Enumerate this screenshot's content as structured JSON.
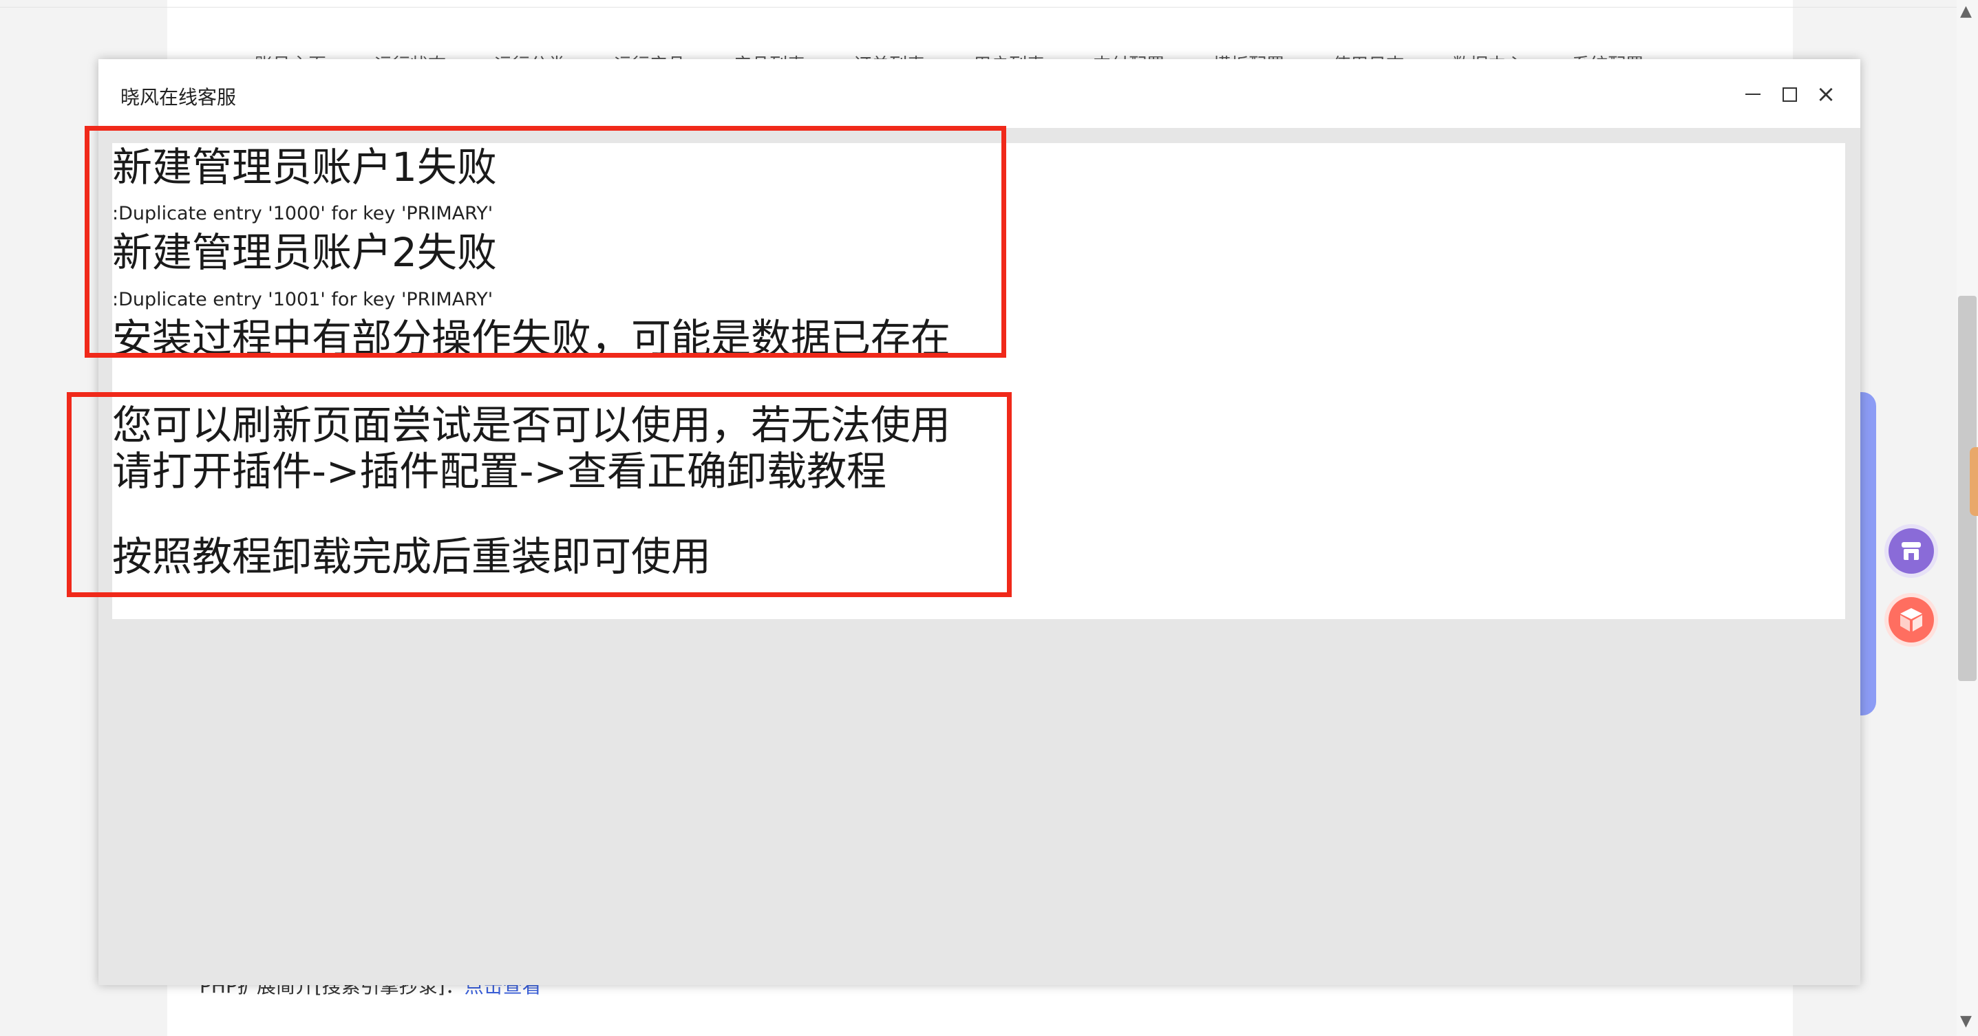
{
  "background": {
    "nav_items": [
      "账号主页",
      "运行状态",
      "运行分类",
      "运行产品",
      "产品列表",
      "订单列表",
      "用户列表",
      "支付配置",
      "模板配置",
      "使用日志",
      "数据中心",
      "系统配置"
    ],
    "footer_label": "PHP扩展简介[搜索引擎抄录]：",
    "footer_link": "点击查看"
  },
  "dialog": {
    "title": "晓风在线客服",
    "controls": {
      "minimize": "minimize",
      "maximize": "maximize",
      "close": "×"
    },
    "messages": {
      "error1_title": "新建管理员账户1失败",
      "error1_detail": ":Duplicate entry '1000' for key 'PRIMARY'",
      "error2_title": "新建管理员账户2失败",
      "error2_detail": ":Duplicate entry '1001' for key 'PRIMARY'",
      "summary": "安装过程中有部分操作失败，可能是数据已存在",
      "advice_line1": "您可以刷新页面尝试是否可以使用，若无法使用",
      "advice_line2": "请打开插件->插件配置->查看正确卸载教程",
      "advice_line3": "按照教程卸载完成后重装即可使用"
    }
  },
  "colors": {
    "highlight_border": "#f0291a",
    "dialog_body": "#e6e6e6",
    "float_store": "#8a6bd8",
    "float_cube": "#ff6e60"
  },
  "icons": [
    "minimize-icon",
    "maximize-icon",
    "close-icon",
    "store-icon",
    "cube-icon"
  ]
}
